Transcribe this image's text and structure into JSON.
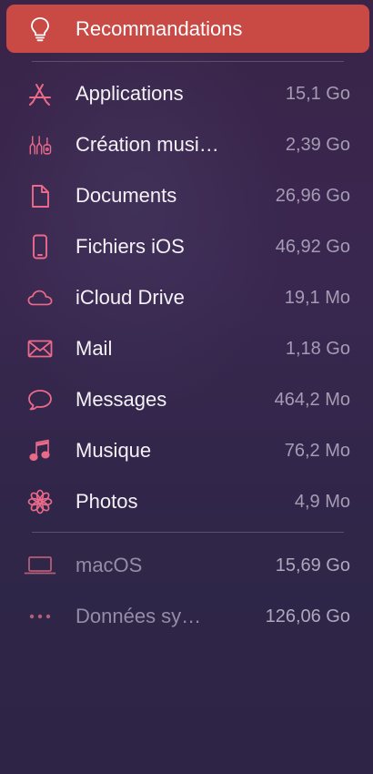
{
  "colors": {
    "accent": "#c94945",
    "icon_pink": "#ea6a8a",
    "dim_icon": "#b45e78",
    "size_text": "#a59cb4"
  },
  "recommendations": {
    "label": "Recommandations",
    "icon": "lightbulb-icon"
  },
  "categories": [
    {
      "label": "Applications",
      "size": "15,1 Go",
      "icon": "app-store-icon"
    },
    {
      "label": "Création musi…",
      "size": "2,39 Go",
      "icon": "guitar-icon"
    },
    {
      "label": "Documents",
      "size": "26,96 Go",
      "icon": "document-icon"
    },
    {
      "label": "Fichiers iOS",
      "size": "46,92 Go",
      "icon": "iphone-icon"
    },
    {
      "label": "iCloud Drive",
      "size": "19,1 Mo",
      "icon": "cloud-icon"
    },
    {
      "label": "Mail",
      "size": "1,18 Go",
      "icon": "envelope-icon"
    },
    {
      "label": "Messages",
      "size": "464,2 Mo",
      "icon": "message-bubble-icon"
    },
    {
      "label": "Musique",
      "size": "76,2 Mo",
      "icon": "music-note-icon"
    },
    {
      "label": "Photos",
      "size": "4,9 Mo",
      "icon": "photos-flower-icon"
    }
  ],
  "system": [
    {
      "label": "macOS",
      "size": "15,69 Go",
      "icon": "laptop-icon"
    },
    {
      "label": "Données sy…",
      "size": "126,06 Go",
      "icon": "ellipsis-icon"
    }
  ]
}
